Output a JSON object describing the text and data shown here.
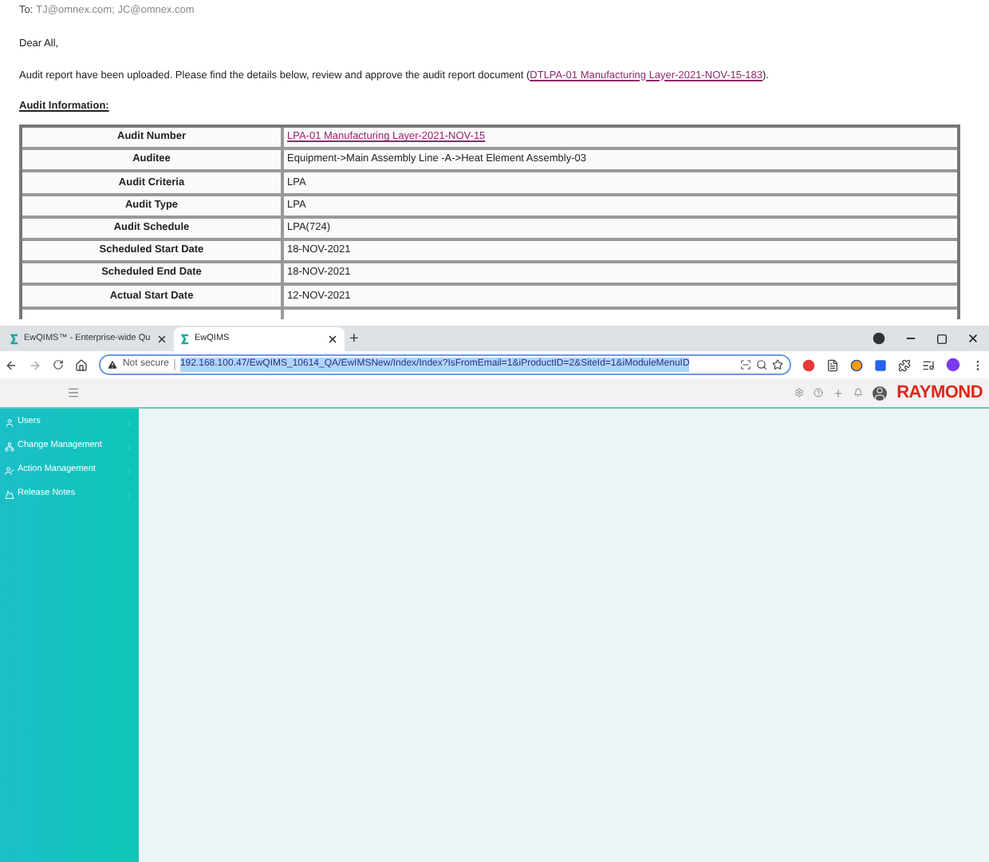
{
  "email": {
    "to_label": "To:",
    "recipients": "TJ@omnex.com; JC@omnex.com",
    "greeting": "Dear All,",
    "body": {
      "before": "Audit report have been uploaded. Please find the details below, review and approve the audit report document (",
      "link": "DTLPA-01 Manufacturing Layer-2021-NOV-15-183",
      "after": ")."
    },
    "section_title": "Audit Information:",
    "table": {
      "rows": [
        {
          "label": "Audit Number",
          "value": "LPA-01 Manufacturing Layer-2021-NOV-15",
          "kind": "link"
        },
        {
          "label": "Auditee",
          "value": "Equipment->Main Assembly Line -A->Heat Element Assembly-03",
          "kind": "text"
        },
        {
          "label": "Audit Criteria",
          "value": "LPA",
          "kind": "text"
        },
        {
          "label": "Audit Type",
          "value": "LPA",
          "kind": "text"
        },
        {
          "label": "Audit Schedule",
          "value": "LPA(724)",
          "kind": "text"
        },
        {
          "label": "Scheduled Start Date",
          "value": "18-NOV-2021",
          "kind": "text"
        },
        {
          "label": "Scheduled End Date",
          "value": "18-NOV-2021",
          "kind": "text"
        },
        {
          "label": "Actual Start Date",
          "value": "12-NOV-2021",
          "kind": "text"
        }
      ]
    }
  },
  "browser": {
    "tabs": [
      {
        "title": "EwQIMS™ - Enterprise-wide Qu",
        "selected": false
      },
      {
        "title": "EwQIMS",
        "selected": true
      }
    ],
    "new_tab": "+",
    "address": {
      "security": "Not secure",
      "url": "192.168.100.47/EwQIMS_10614_QA/EwIMSNew/Index/Index?IsFromEmail=1&iProductID=2&SiteId=1&iModuleMenuID"
    },
    "app": {
      "logo": "RAYMOND",
      "menu_items": [
        {
          "label": "Users",
          "kind": "user"
        },
        {
          "label": "Change Management",
          "kind": "network"
        },
        {
          "label": "Action Management",
          "kind": "user-check"
        },
        {
          "label": "Release Notes",
          "kind": "release"
        }
      ]
    }
  }
}
